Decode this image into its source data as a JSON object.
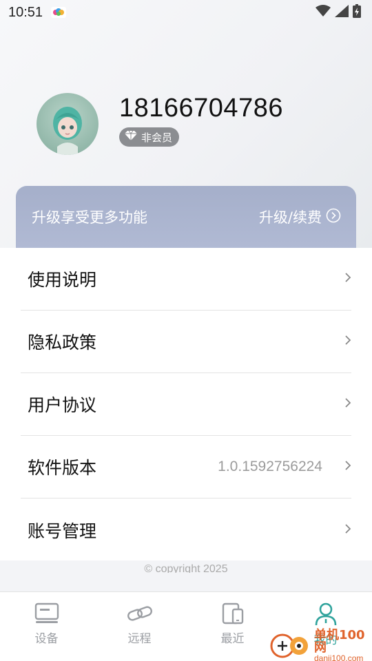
{
  "status_bar": {
    "time": "10:51"
  },
  "profile": {
    "phone": "18166704786",
    "membership": "非会员"
  },
  "upgrade": {
    "text": "升级享受更多功能",
    "action": "升级/续费"
  },
  "menu": [
    {
      "label": "使用说明",
      "value": ""
    },
    {
      "label": "隐私政策",
      "value": ""
    },
    {
      "label": "用户协议",
      "value": ""
    },
    {
      "label": "软件版本",
      "value": "1.0.1592756224"
    },
    {
      "label": "账号管理",
      "value": ""
    }
  ],
  "copyright": "© copyright 2025",
  "nav": [
    {
      "label": "设备",
      "icon": "device-icon"
    },
    {
      "label": "远程",
      "icon": "link-icon"
    },
    {
      "label": "最近",
      "icon": "recent-devices-icon"
    },
    {
      "label": "我的",
      "icon": "user-icon"
    }
  ],
  "watermark": {
    "title": "单机100网",
    "url": "danji100.com"
  },
  "colors": {
    "accent": "#2fa39c",
    "banner": "#a5afca",
    "inactive": "#9b9ea3"
  }
}
